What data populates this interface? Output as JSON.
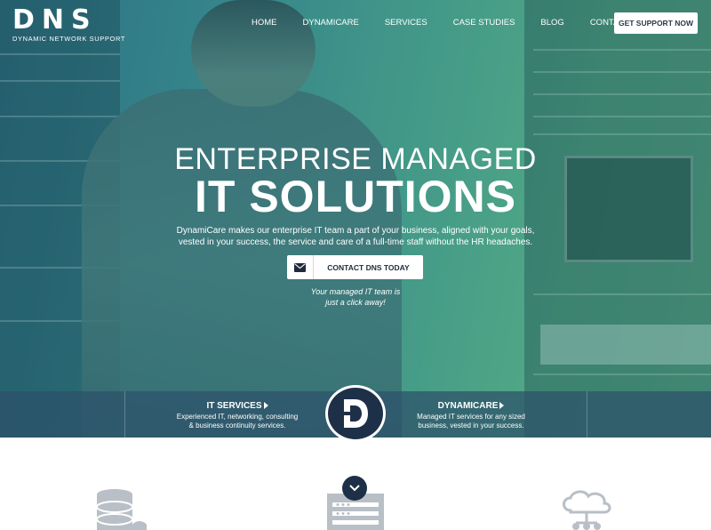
{
  "brand": {
    "logo_text": "DNS",
    "tagline": "DYNAMIC NETWORK SUPPORT"
  },
  "nav": {
    "items": [
      "HOME",
      "DYNAMICARE",
      "SERVICES",
      "CASE STUDIES",
      "BLOG",
      "CONTACT US"
    ],
    "cta_label": "GET SUPPORT NOW"
  },
  "hero": {
    "title_line1": "ENTERPRISE MANAGED",
    "title_line2": "IT SOLUTIONS",
    "description": "DynamiCare makes our enterprise IT team a part of your business, aligned with your goals, vested in your success, the service and care of a full-time staff without the HR headaches.",
    "cta_label": "CONTACT DNS TODAY",
    "note_line1": "Your managed IT team is",
    "note_line2": "just a click away!"
  },
  "features": {
    "left": {
      "title": "IT SERVICES",
      "line1": "Experienced IT, networking, consulting",
      "line2": "& business continuity services."
    },
    "right": {
      "title": "DYNAMICARE",
      "line1": "Managed IT services for any sized",
      "line2": "business, vested in your success."
    },
    "badge_letter": "D"
  },
  "colors": {
    "navy": "#1e3048",
    "icon_gray": "#b9bfc6",
    "hero_teal": "#3a8a8e"
  },
  "icons": [
    "envelope-icon",
    "caret-right-icon",
    "chevron-down-icon",
    "database-icon",
    "server-rack-icon",
    "cloud-network-icon"
  ]
}
